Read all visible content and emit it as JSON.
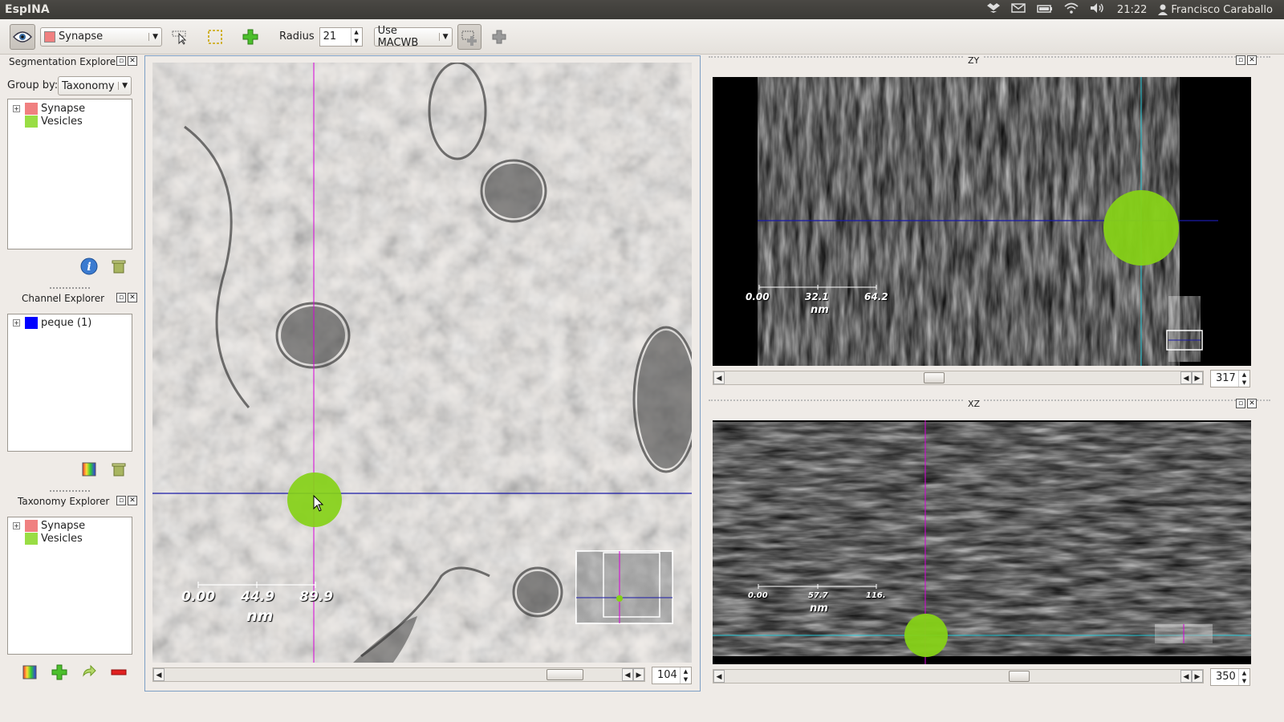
{
  "system_bar": {
    "app_title": "EspINA",
    "clock": "21:22",
    "user": "Francisco Caraballo"
  },
  "toolbar": {
    "taxonomy_selected": "Synapse",
    "taxonomy_color": "#f08080",
    "radius_label": "Radius",
    "radius_value": "21",
    "filter_selected": "Use MACWB"
  },
  "segmentation_explorer": {
    "title": "Segmentation Explorer",
    "group_by_label": "Group by:",
    "group_by_value": "Taxonomy",
    "items": [
      {
        "label": "Synapse",
        "color": "#f08080"
      },
      {
        "label": "Vesicles",
        "color": "#99dd44"
      }
    ]
  },
  "channel_explorer": {
    "title": "Channel Explorer",
    "items": [
      {
        "label": "peque (1)",
        "color": "#0000ff"
      }
    ]
  },
  "taxonomy_explorer": {
    "title": "Taxonomy Explorer",
    "items": [
      {
        "label": "Synapse",
        "color": "#f08080"
      },
      {
        "label": "Vesicles",
        "color": "#99dd44"
      }
    ]
  },
  "xy_view": {
    "ruler": {
      "ticks": [
        "0.00",
        "44.9",
        "89.9"
      ],
      "unit": "nm"
    },
    "slice_value": "104"
  },
  "zy_view": {
    "title": "ZY",
    "ruler": {
      "ticks": [
        "0.00",
        "32.1",
        "64.2"
      ],
      "unit": "nm"
    },
    "slice_value": "317"
  },
  "xz_view": {
    "title": "XZ",
    "ruler": {
      "ticks": [
        "0.00",
        "57.7",
        "116."
      ],
      "unit": "nm"
    },
    "slice_value": "350"
  }
}
